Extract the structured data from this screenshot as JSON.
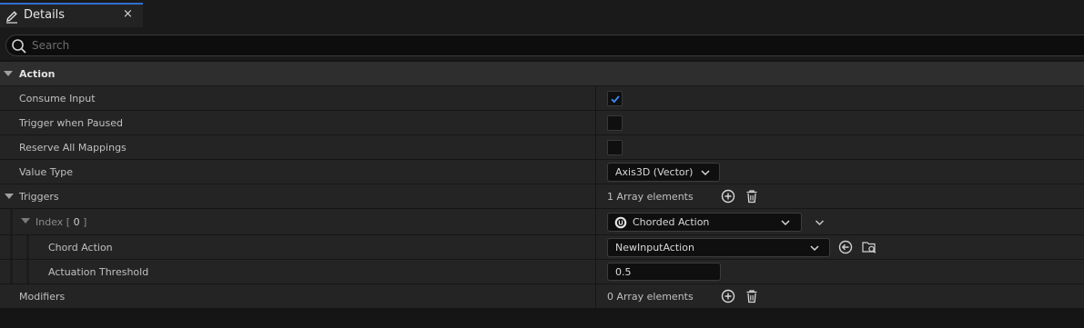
{
  "tab": {
    "title": "Details",
    "close_label": "×"
  },
  "search": {
    "placeholder": "Search"
  },
  "sections": {
    "action": {
      "title": "Action",
      "consume_input": {
        "label": "Consume Input",
        "checked": true
      },
      "trigger_when_paused": {
        "label": "Trigger when Paused",
        "checked": false
      },
      "reserve_all_mappings": {
        "label": "Reserve All Mappings",
        "checked": false
      },
      "value_type": {
        "label": "Value Type",
        "value": "Axis3D (Vector)"
      },
      "triggers": {
        "label": "Triggers",
        "count_text": "1 Array elements",
        "index": {
          "label_prefix": "Index [ ",
          "number": "0",
          "label_suffix": " ]",
          "value": "Chorded Action"
        },
        "chord_action": {
          "label": "Chord Action",
          "value": "NewInputAction"
        },
        "actuation_threshold": {
          "label": "Actuation Threshold",
          "value": "0.5"
        }
      },
      "modifiers": {
        "label": "Modifiers",
        "count_text": "0 Array elements"
      }
    }
  },
  "icons": {
    "tab": "pencil-icon",
    "search": "search-icon",
    "add": "add-element-icon",
    "delete": "trash-icon",
    "reset": "use-selected-icon",
    "browse": "browse-asset-icon",
    "class": "unreal-logo-icon"
  },
  "colors": {
    "accent": "#2f6fd0",
    "checkmark": "#3d8cf0",
    "panel": "#242424",
    "header": "#2e2e2e"
  }
}
